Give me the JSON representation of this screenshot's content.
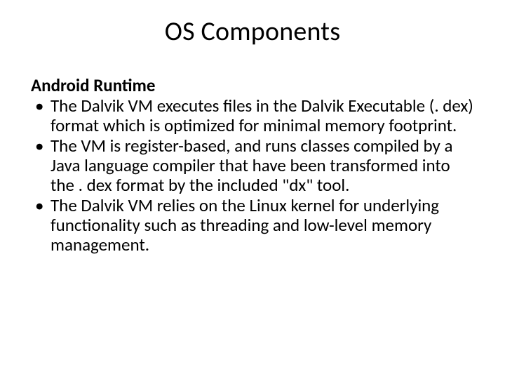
{
  "slide": {
    "title": "OS Components",
    "subheading": "Android Runtime",
    "bullets": [
      "The Dalvik VM executes files in the Dalvik Executable (. dex) format which is optimized for minimal memory footprint.",
      "The VM is register-based, and runs classes compiled by a Java language compiler that have been transformed into the . dex format by the included \"dx\" tool.",
      "The Dalvik VM relies on the Linux kernel for underlying functionality such as threading and low-level memory management."
    ]
  }
}
